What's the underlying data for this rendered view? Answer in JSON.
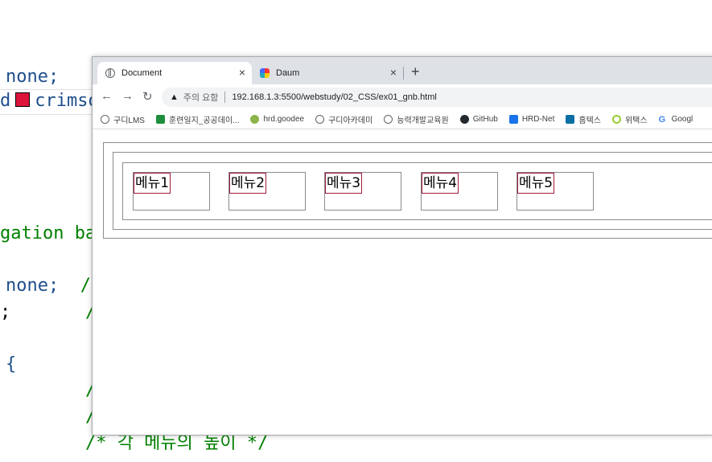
{
  "editor": {
    "lines": [
      {
        "parts": [
          {
            "t": "none;",
            "c": "kw"
          }
        ]
      },
      {
        "parts": [
          {
            "t": "d",
            "c": "kw"
          },
          {
            "swatch": true
          },
          {
            "t": "crimso",
            "c": "kw"
          }
        ]
      },
      {
        "parts": [
          {
            "t": "gation bar",
            "c": "cm"
          }
        ]
      },
      {
        "parts": [
          {
            "t": "none;",
            "c": "kw"
          },
          {
            "t": "  /*",
            "c": "cm"
          }
        ]
      },
      {
        "parts": [
          {
            "t": ";",
            "c": "tx"
          },
          {
            "t": "       /*",
            "c": "cm"
          }
        ]
      },
      {
        "parts": [
          {
            "t": "{",
            "c": "kw"
          }
        ]
      },
      {
        "parts": [
          {
            "t": "        /*",
            "c": "cm"
          }
        ]
      },
      {
        "parts": [
          {
            "t": "        /*",
            "c": "cm"
          }
        ]
      },
      {
        "parts": [
          {
            "t": "        /* 각 메뉴의 높이 */",
            "c": "cm"
          }
        ]
      }
    ],
    "swatch_color": "#dc143c"
  },
  "browser": {
    "tabs": [
      {
        "title": "Document",
        "close": "×",
        "icon": "globe-icon"
      },
      {
        "title": "Daum",
        "close": "×",
        "icon": "daum-icon"
      }
    ],
    "new_tab": "+",
    "nav": {
      "back": "←",
      "forward": "→",
      "reload": "↻"
    },
    "omnibox": {
      "warning": "주의 요함",
      "url": "192.168.1.3:5500/webstudy/02_CSS/ex01_gnb.html"
    },
    "bookmarks": [
      {
        "label": "구디LMS",
        "icon": "globe"
      },
      {
        "label": "훈련일지_공공데이...",
        "icon": "green"
      },
      {
        "label": "hrd.goodee",
        "icon": "olive"
      },
      {
        "label": "구디아카데미",
        "icon": "globe"
      },
      {
        "label": "능력개발교육원",
        "icon": "globe"
      },
      {
        "label": "GitHub",
        "icon": "dark"
      },
      {
        "label": "HRD-Net",
        "icon": "blue"
      },
      {
        "label": "홈텍스",
        "icon": "teal"
      },
      {
        "label": "위택스",
        "icon": "ring"
      },
      {
        "label": "Googl",
        "icon": "g"
      }
    ]
  },
  "page": {
    "menu": [
      "메뉴1",
      "메뉴2",
      "메뉴3",
      "메뉴4",
      "메뉴5"
    ]
  }
}
